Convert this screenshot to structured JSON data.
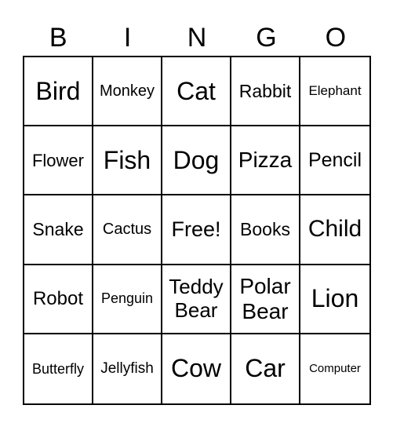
{
  "header": [
    "B",
    "I",
    "N",
    "G",
    "O"
  ],
  "cells": [
    "Bird",
    "Monkey",
    "Cat",
    "Rabbit",
    "Elephant",
    "Flower",
    "Fish",
    "Dog",
    "Pizza",
    "Pencil",
    "Snake",
    "Cactus",
    "Free!",
    "Books",
    "Child",
    "Robot",
    "Penguin",
    "Teddy Bear",
    "Polar Bear",
    "Lion",
    "Butterfly",
    "Jellyfish",
    "Cow",
    "Car",
    "Computer"
  ]
}
